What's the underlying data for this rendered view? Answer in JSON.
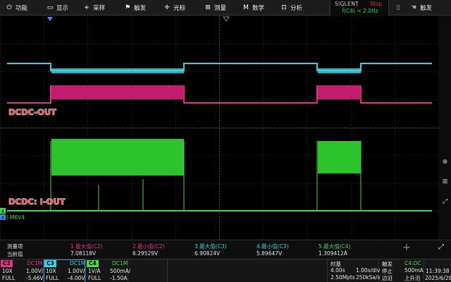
{
  "menu": [
    {
      "icon": "power-icon",
      "glyph": "⏻",
      "label": "功能"
    },
    {
      "icon": "monitor-icon",
      "glyph": "▭",
      "label": "显示"
    },
    {
      "icon": "plus-icon",
      "glyph": "+",
      "label": "采样"
    },
    {
      "icon": "flag-icon",
      "glyph": "⚑",
      "label": "触发"
    },
    {
      "icon": "cursor-icon",
      "glyph": "✛",
      "label": "光标"
    },
    {
      "icon": "ruler-icon",
      "glyph": "⊞",
      "label": "测量"
    },
    {
      "icon": "math-icon",
      "glyph": "Μ",
      "label": "数学"
    },
    {
      "icon": "analysis-icon",
      "glyph": "⊡",
      "label": "分析"
    }
  ],
  "brand": "SIGLENT",
  "run_state": "Stop",
  "trigger_freq": "f(C4) < 2.0Hz",
  "labels": {
    "top": "DCDC-OUT",
    "bottom": "DCDC: I-OUT",
    "c4_marker": "4",
    "i_m6v4": "I-M6V4",
    "i_marker": "4"
  },
  "measurements": {
    "row1_label": "测量项",
    "row2_label": "当前值",
    "items": [
      {
        "head": "1.最大值(C2)",
        "value": "7.08118V",
        "color": "#e0338a"
      },
      {
        "head": "2.最小值(C2)",
        "value": "6.29529V",
        "color": "#e0338a"
      },
      {
        "head": "3.最大值(C3)",
        "value": "6.90824V",
        "color": "#38d2e0"
      },
      {
        "head": "4.最小值(C3)",
        "value": "5.89647V",
        "color": "#38d2e0"
      },
      {
        "head": "5.最大值(C4)",
        "value": "1.309412A",
        "color": "#4fd44f"
      }
    ]
  },
  "channels": [
    {
      "tag": "C2",
      "color": "#e0338a",
      "coupling": "DC1M",
      "probe": "10X",
      "scale": "1.00V/",
      "bw": "FULL",
      "offset": "-5.46V"
    },
    {
      "tag": "C3",
      "color": "#38d2e0",
      "coupling": "DC1M",
      "probe": "10X",
      "scale": "1.00V/",
      "bw": "FULL",
      "offset": "-4.00V"
    },
    {
      "tag": "C4",
      "color": "#4fd44f",
      "coupling": "DC1M",
      "probe": "1V/A",
      "scale": "500mA/",
      "bw": "FULL",
      "offset": "-1.50A"
    }
  ],
  "timebase": {
    "title": "时基",
    "scale": "4.00s",
    "sample_rate": "2.50Mpts",
    "delay": "1.00s/div",
    "rate2": "250kSa/s"
  },
  "trigger": {
    "title": "触发",
    "source": "C4:DC",
    "state": "停止",
    "level": "500mA",
    "edge": "边沿",
    "slope": "上升沿"
  },
  "clock": {
    "time": "11:39:38",
    "date": "2025/6/28"
  },
  "colors": {
    "c2": "#e0338a",
    "c3": "#38d2e0",
    "c4": "#4fd44f",
    "grid": "#2e2e2e",
    "label_text": "#ff2222"
  }
}
